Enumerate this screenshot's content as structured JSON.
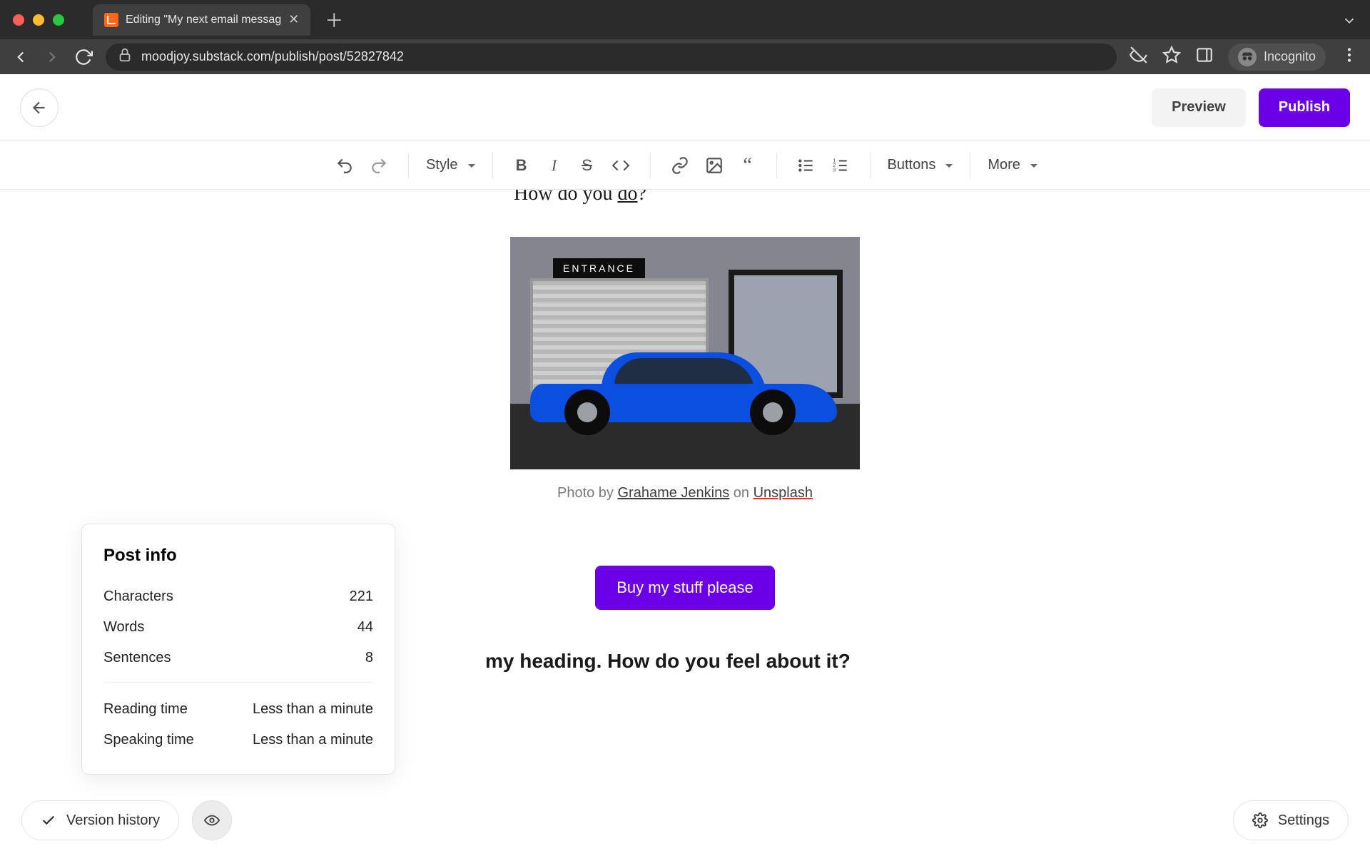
{
  "browser": {
    "tab_title": "Editing \"My next email messag",
    "url": "moodjoy.substack.com/publish/post/52827842",
    "incognito_label": "Incognito"
  },
  "header": {
    "preview": "Preview",
    "publish": "Publish"
  },
  "toolbar": {
    "style": "Style",
    "buttons": "Buttons",
    "more": "More"
  },
  "content": {
    "partial_line_prefix": "How do you ",
    "partial_line_underlined": "do",
    "partial_line_suffix": "?",
    "image_sign": "ENTRANCE",
    "caption_prefix": "Photo by ",
    "caption_author": "Grahame Jenkins",
    "caption_middle": " on ",
    "caption_source": "Unsplash",
    "cta": "Buy my stuff please",
    "heading_visible": "my heading. How do you feel about it?"
  },
  "post_info": {
    "title": "Post info",
    "rows1": [
      {
        "label": "Characters",
        "value": "221"
      },
      {
        "label": "Words",
        "value": "44"
      },
      {
        "label": "Sentences",
        "value": "8"
      }
    ],
    "rows2": [
      {
        "label": "Reading time",
        "value": "Less than a minute"
      },
      {
        "label": "Speaking time",
        "value": "Less than a minute"
      }
    ]
  },
  "bottom": {
    "version_history": "Version history",
    "settings": "Settings"
  },
  "colors": {
    "accent": "#6b00e6"
  }
}
